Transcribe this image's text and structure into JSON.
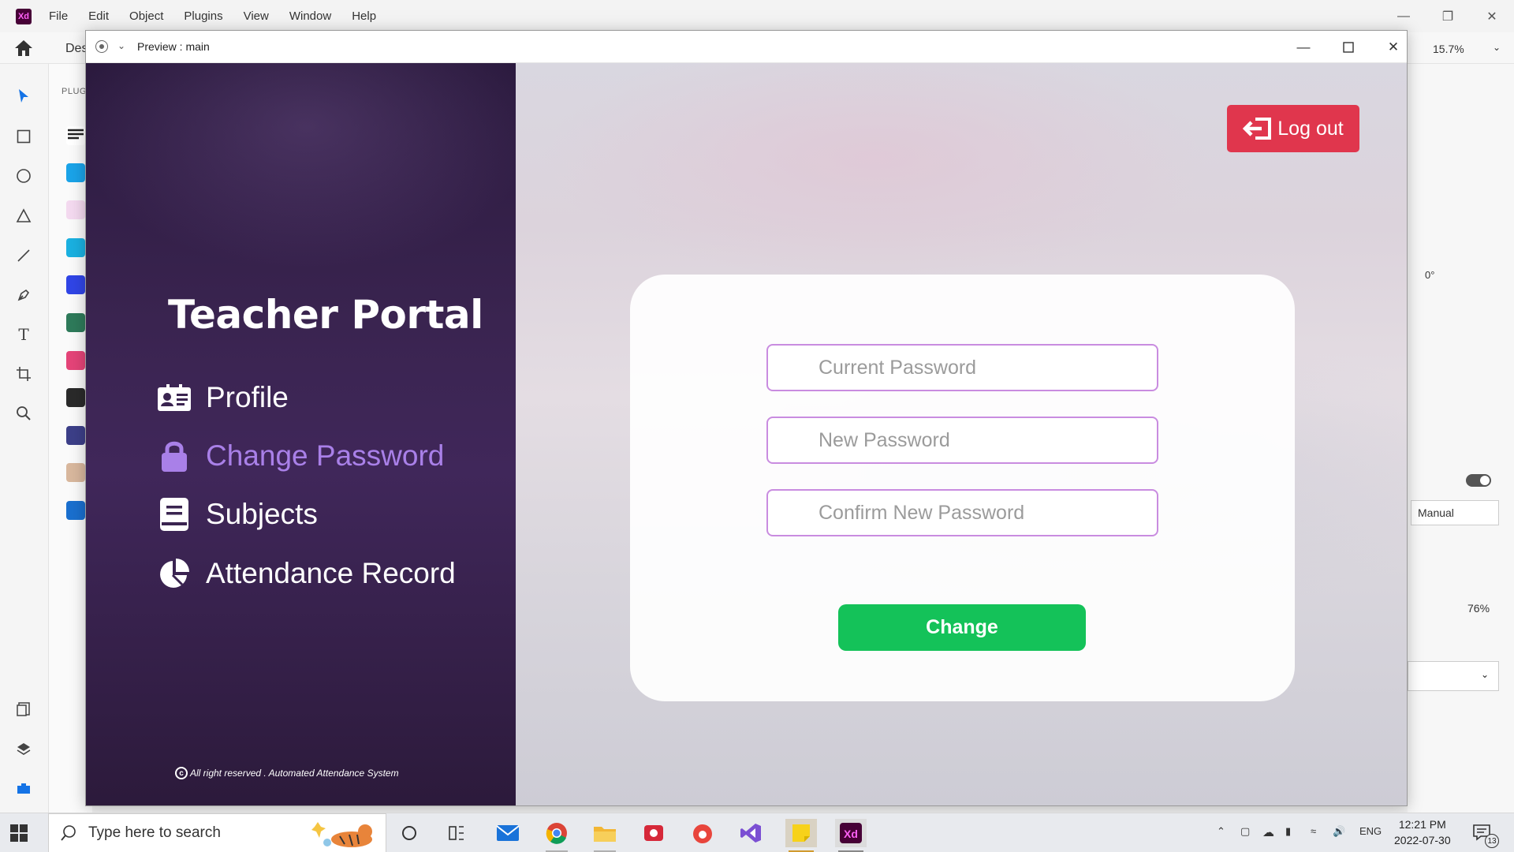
{
  "app": {
    "menu": [
      "File",
      "Edit",
      "Object",
      "Plugins",
      "View",
      "Window",
      "Help"
    ],
    "design_tab": "Des",
    "zoom": "15.7%",
    "plugins_label": "PLUG",
    "right_panel": {
      "rotation": "0°",
      "mode": "Manual",
      "percent": "76%"
    }
  },
  "preview": {
    "title": "Preview : main"
  },
  "portal": {
    "title": "Teacher Portal",
    "nav": [
      {
        "label": "Profile",
        "icon": "profile-card-icon"
      },
      {
        "label": "Change Password",
        "icon": "lock-icon",
        "active": true
      },
      {
        "label": "Subjects",
        "icon": "book-icon"
      },
      {
        "label": "Attendance Record",
        "icon": "pie-chart-icon"
      }
    ],
    "footer": "All right reserved . Automated Attendance System",
    "logout_label": "Log out",
    "form": {
      "current_password_placeholder": "Current Password",
      "new_password_placeholder": "New Password",
      "confirm_password_placeholder": "Confirm New Password",
      "submit_label": "Change"
    },
    "colors": {
      "accent": "#a980e8",
      "logout": "#e0364d",
      "submit": "#14c259",
      "field_border": "#c98ce0"
    }
  },
  "taskbar": {
    "search_placeholder": "Type here to search",
    "language": "ENG",
    "time": "12:21 PM",
    "date": "2022-07-30",
    "notifications": "13"
  }
}
